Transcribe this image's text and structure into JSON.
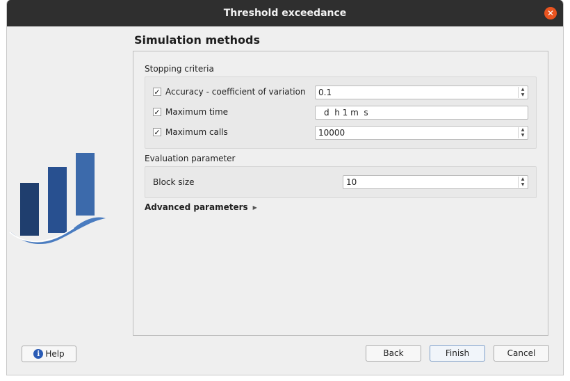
{
  "window": {
    "title": "Threshold exceedance"
  },
  "page": {
    "title": "Simulation methods"
  },
  "stopping": {
    "label": "Stopping criteria",
    "accuracy": {
      "label": "Accuracy - coefficient of variation",
      "value": "0.1",
      "checked": true
    },
    "max_time": {
      "label": "Maximum time",
      "value": "d  h 1 m  s",
      "checked": true
    },
    "max_calls": {
      "label": "Maximum calls",
      "value": "10000",
      "checked": true
    }
  },
  "evaluation": {
    "label": "Evaluation parameter",
    "block_size": {
      "label": "Block size",
      "value": "10"
    }
  },
  "advanced": {
    "label": "Advanced parameters"
  },
  "buttons": {
    "help": "Help",
    "back": "Back",
    "finish": "Finish",
    "cancel": "Cancel"
  },
  "icons": {
    "close": "close-icon",
    "help": "info-icon",
    "expand": "triangle-right-icon",
    "check": "checkmark-icon"
  },
  "colors": {
    "titlebar": "#2f2f2f",
    "close": "#e95420",
    "logo_dark": "#1f3e6e",
    "logo_light": "#4a7cc0"
  }
}
